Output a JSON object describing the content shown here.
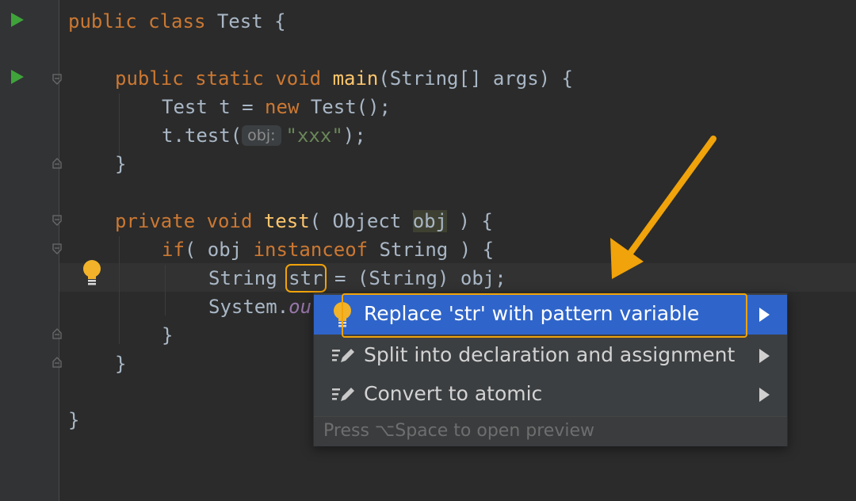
{
  "editor": {
    "line1": {
      "kw1": "public",
      "kw2": "class",
      "name": "Test",
      "brace": "{"
    },
    "line3": {
      "kw1": "public",
      "kw2": "static",
      "kw3": "void",
      "method": "main",
      "params": "(String[] args) {"
    },
    "line4": {
      "pre": "Test t = ",
      "kw": "new",
      "post": " Test();",
      "semi": ""
    },
    "line5": {
      "pre": "t.test(",
      "hint": "obj:",
      "str": "\"xxx\"",
      "post": ");"
    },
    "line6": {
      "text": "}"
    },
    "line8": {
      "kw1": "private",
      "kw2": "void",
      "method": "test",
      "pre": "( Object ",
      "param": "obj",
      "post": " ) {"
    },
    "line9": {
      "kw1": "if",
      "pre": "( obj ",
      "kw2": "instanceof",
      "post": " String ) {"
    },
    "line10": {
      "pre": "String ",
      "var": "str",
      "post": " = (String) obj;"
    },
    "line11": {
      "pre": "System.",
      "field": "out"
    },
    "line12": {
      "text": "}"
    },
    "line13": {
      "text": "}"
    },
    "line15": {
      "text": "}"
    }
  },
  "intention_popup": {
    "items": [
      {
        "label": "Replace 'str' with pattern variable",
        "icon": "lightbulb-icon",
        "selected": true
      },
      {
        "label": "Split into declaration and assignment",
        "icon": "edit-icon",
        "selected": false
      },
      {
        "label": "Convert to atomic",
        "icon": "edit-icon",
        "selected": false
      }
    ],
    "footer": "Press ⌥Space to open preview"
  },
  "colors": {
    "accent": "#2f65ca",
    "annotation": "#f0a30a",
    "keyword": "#cc7832",
    "function": "#ffc66d",
    "string": "#6a8759"
  }
}
